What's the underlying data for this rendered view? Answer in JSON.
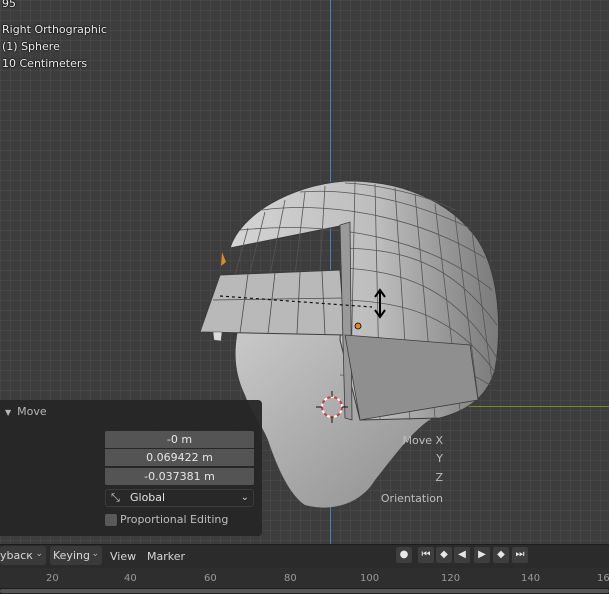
{
  "viewport": {
    "frame_counter": "95",
    "view_name": "Right Orthographic",
    "object_name": "(1) Sphere",
    "scale_info": "10 Centimeters"
  },
  "operator_panel": {
    "title": "Move",
    "move_x_label": "Move X",
    "move_x_value": "-0 m",
    "y_label": "Y",
    "y_value": "0.069422 m",
    "z_label": "Z",
    "z_value": "-0.037381 m",
    "orientation_label": "Orientation",
    "orientation_value": "Global",
    "proportional_label": "Proportional Editing",
    "proportional_checked": false
  },
  "timeline": {
    "menus": {
      "playback": "ybacк",
      "keying": "Keying",
      "view": "View",
      "marker": "Marker"
    },
    "ticks": [
      "20",
      "40",
      "60",
      "80",
      "100",
      "120",
      "140",
      "16"
    ]
  },
  "colors": {
    "viewport_bg": "#3d3d3d",
    "y_axis": "#4b7fbf",
    "x_axis": "#6e8c2e",
    "selected_vertex": "#e08a1e"
  }
}
